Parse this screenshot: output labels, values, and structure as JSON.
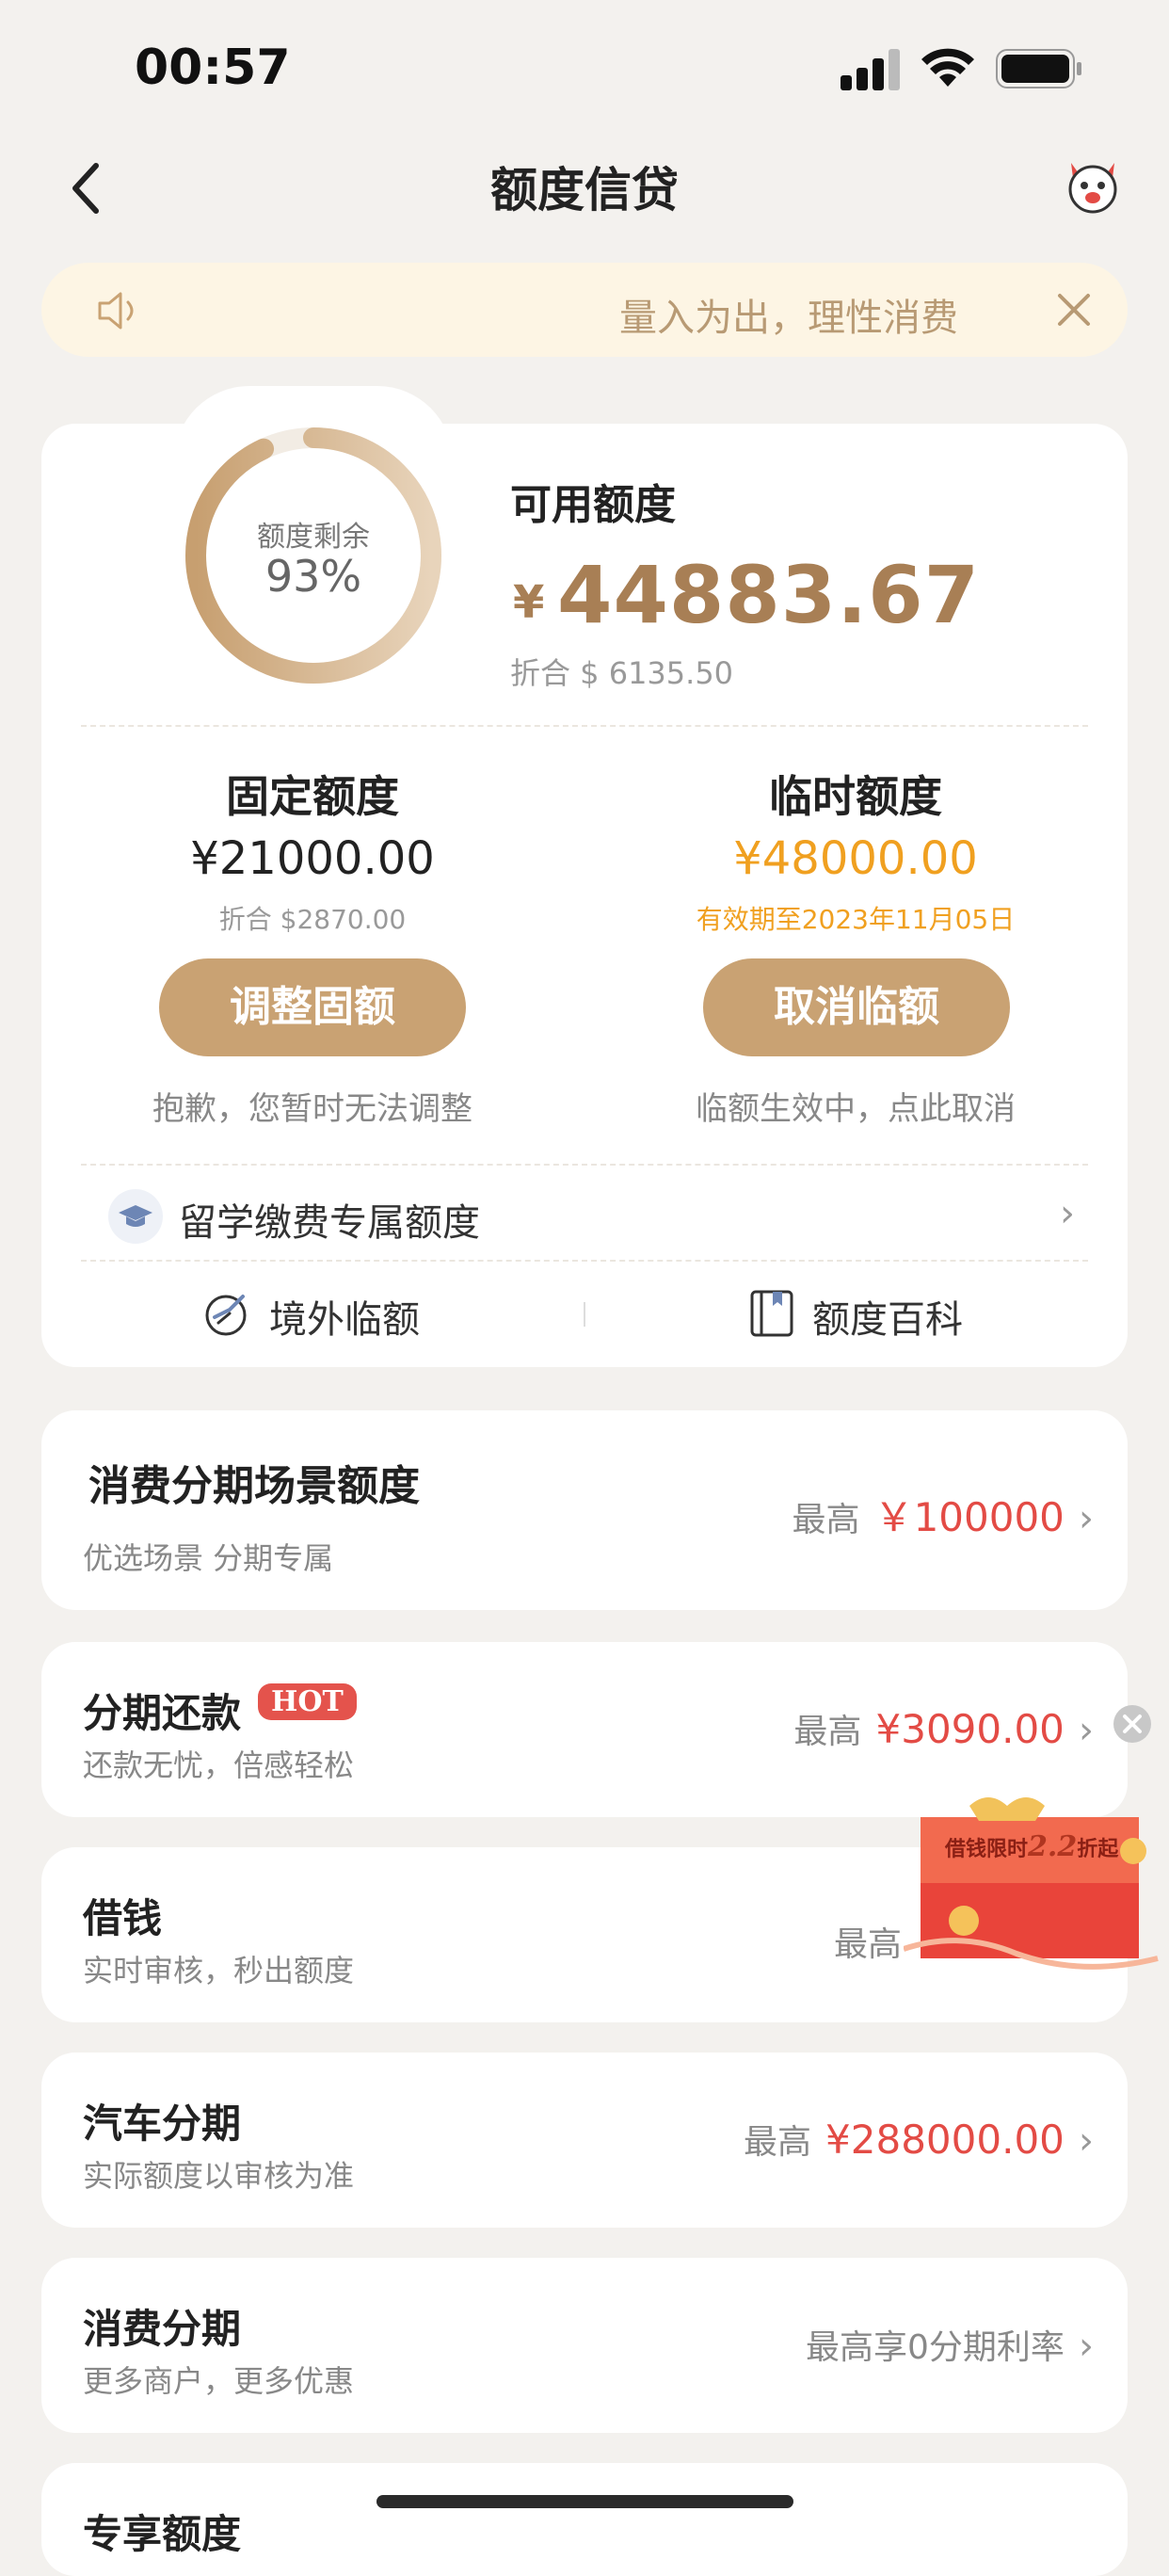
{
  "status": {
    "time": "00:57"
  },
  "topbar": {
    "title": "额度信贷"
  },
  "notice": {
    "text": "量入为出，理性消费"
  },
  "quota": {
    "ring_label": "额度剩余",
    "ring_percent": "93%",
    "ring_fraction": 0.93,
    "available_label": "可用额度",
    "currency": "¥",
    "available_amount": "44883.67",
    "available_converted": "折合 $ 6135.50"
  },
  "fixed": {
    "title": "固定额度",
    "amount": "¥21000.00",
    "converted": "折合 $2870.00",
    "button": "调整固额",
    "note": "抱歉，您暂时无法调整"
  },
  "temporary": {
    "title": "临时额度",
    "amount": "¥48000.00",
    "validity": "有效期至2023年11月05日",
    "button": "取消临额",
    "note": "临额生效中，点此取消"
  },
  "study_abroad": {
    "label": "留学缴费专属额度"
  },
  "links": {
    "overseas": "境外临额",
    "wiki": "额度百科"
  },
  "scene_card": {
    "title": "消费分期场景额度",
    "subtitle": "优选场景 分期专属",
    "max_label": "最高",
    "max_value": "￥100000"
  },
  "items": [
    {
      "title": "分期还款",
      "badge": "HOT",
      "subtitle": "还款无忧，倍感轻松",
      "max_label": "最高",
      "max_value": "¥3090.00"
    },
    {
      "title": "借钱",
      "subtitle": "实时审核，秒出额度",
      "max_label": "最高",
      "max_value": ""
    },
    {
      "title": "汽车分期",
      "subtitle": "实际额度以审核为准",
      "max_label": "最高",
      "max_value": "¥288000.00"
    },
    {
      "title": "消费分期",
      "subtitle": "更多商户，更多优惠",
      "max_label": "最高享0分期利率",
      "max_value": ""
    },
    {
      "title": "专享额度"
    }
  ],
  "promo": {
    "text_a": "借钱限时",
    "text_b": "2.2",
    "text_c": "折起"
  },
  "colors": {
    "accent": "#c9a273",
    "gold_text": "#a87f55",
    "orange": "#f0a020",
    "red": "#e34b45"
  }
}
